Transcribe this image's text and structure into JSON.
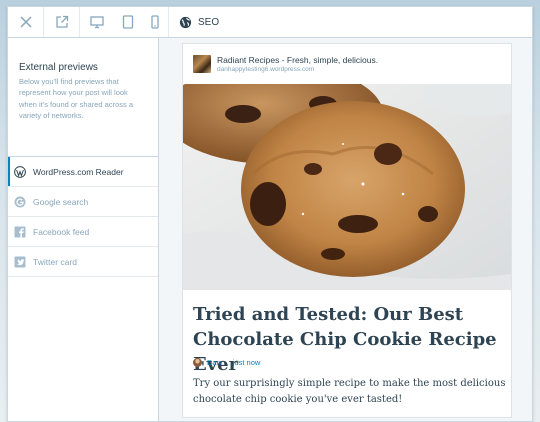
{
  "toolbar": {
    "close_icon": "close-icon",
    "external_icon": "external-link-icon",
    "devices": [
      "desktop-icon",
      "tablet-icon",
      "phone-icon"
    ],
    "seo_label": "SEO"
  },
  "sidebar": {
    "title": "External previews",
    "description": "Below you'll find previews that represent how your post will look when it's found or shared across a variety of networks.",
    "items": [
      {
        "label": "WordPress.com Reader",
        "icon": "wordpress-icon",
        "active": true
      },
      {
        "label": "Google search",
        "icon": "google-icon",
        "active": false
      },
      {
        "label": "Facebook feed",
        "icon": "facebook-icon",
        "active": false
      },
      {
        "label": "Twitter card",
        "icon": "twitter-icon",
        "active": false
      }
    ]
  },
  "preview": {
    "site_name": "Radiant Recipes - Fresh, simple, delicious.",
    "site_url": "danhappytesting6.wordpress.com",
    "image_subject": "chocolate chip cookies",
    "post_title": "Tried and Tested: Our Best Chocolate Chip Cookie Recipe Ever",
    "author": "Dan",
    "time": "just now",
    "excerpt": "Try our surprisingly simple recipe to make the most delicious chocolate chip cookie you've ever tasted!"
  },
  "colors": {
    "accent": "#0087be",
    "text_dark": "#2e4453",
    "text_muted": "#87a6bc",
    "border": "#c8d7e1"
  }
}
